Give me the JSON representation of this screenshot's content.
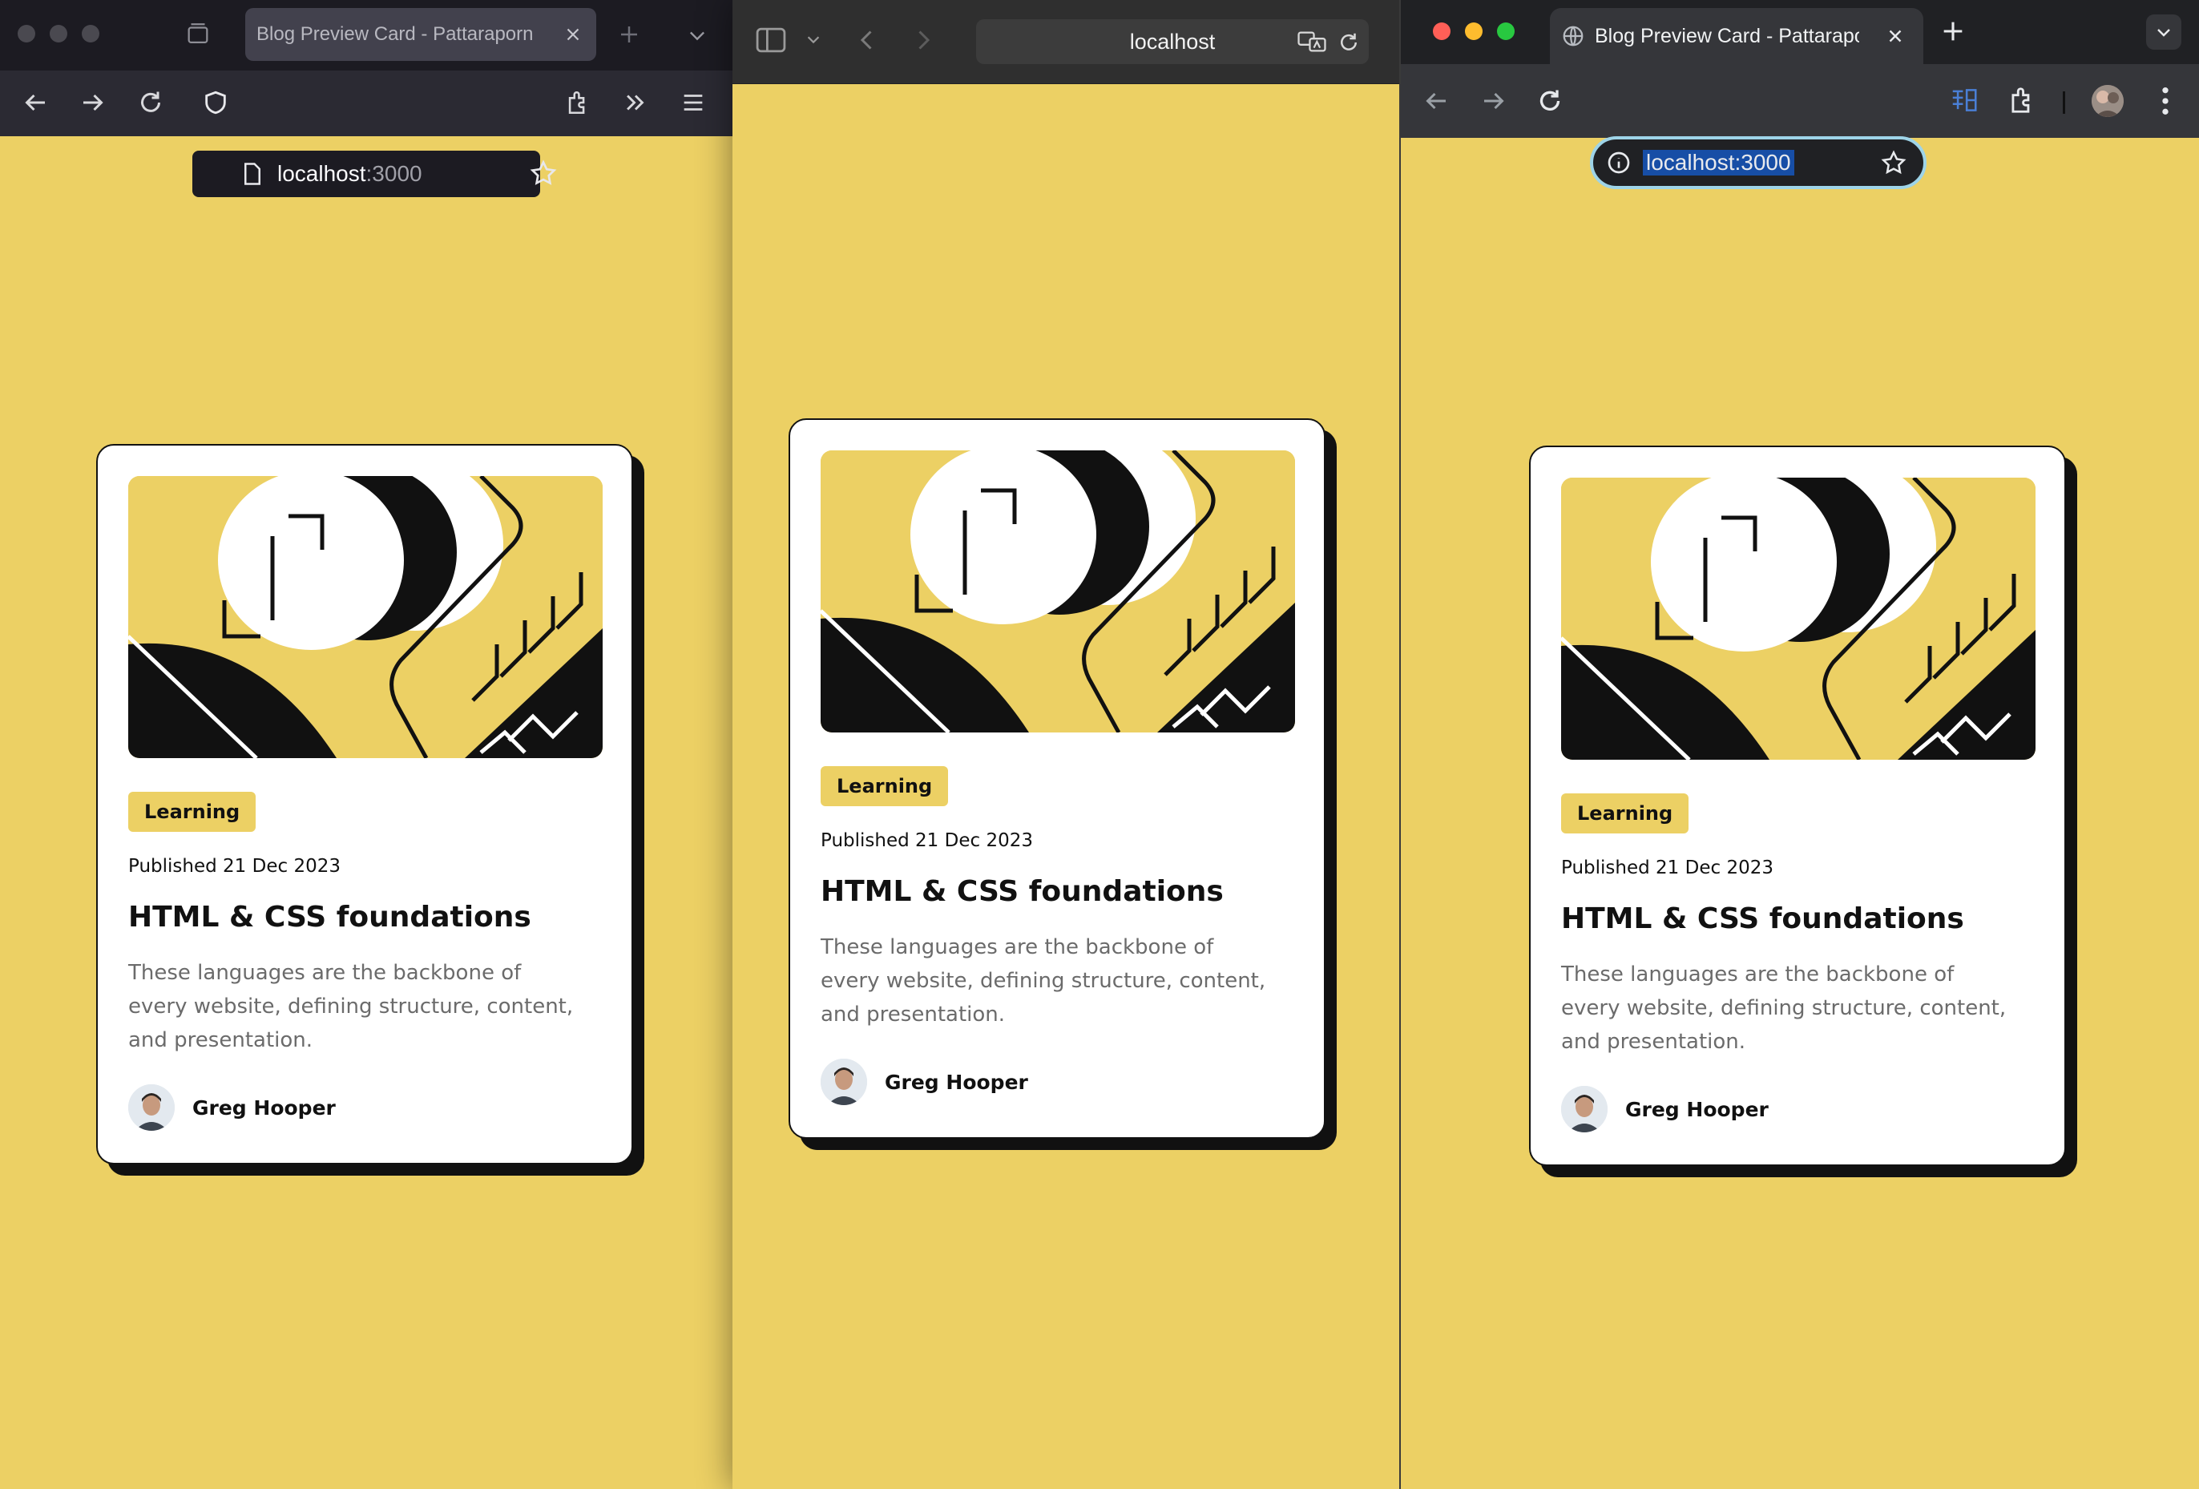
{
  "firefox": {
    "tab_title": "Blog Preview Card - Pattaraporn",
    "url_host": "localhost",
    "url_port": ":3000"
  },
  "safari": {
    "url_host": "localhost"
  },
  "chrome": {
    "tab_title": "Blog Preview Card - Pattaraporn",
    "url_text": "localhost:3000"
  },
  "card": {
    "tag": "Learning",
    "published": "Published 21 Dec 2023",
    "title": "HTML & CSS foundations",
    "description": "These languages are the backbone of every website, defining structure, content, and presentation.",
    "author": "Greg Hooper"
  },
  "colors": {
    "page_background": "#ecd064",
    "card_background": "#ffffff",
    "card_border": "#121212",
    "tag_background": "#ecd064",
    "chrome_url_focus": "#9ed4e8"
  },
  "icons": [
    "back-arrow-icon",
    "forward-arrow-icon",
    "reload-icon",
    "shield-icon",
    "page-icon",
    "star-icon",
    "extensions-icon",
    "chevron-double-right-icon",
    "menu-icon",
    "sidebar-icon",
    "translate-icon",
    "info-icon",
    "globe-icon",
    "close-icon",
    "plus-icon",
    "kebab-menu-icon"
  ]
}
